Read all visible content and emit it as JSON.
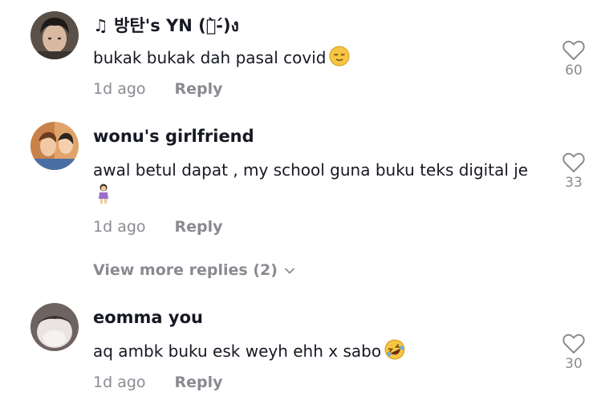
{
  "comments": [
    {
      "username": "♫ 방탄's YN (ง̀-́)ง",
      "text": "bukak bukak dah pasal covid",
      "emoji": "relieved-face-emoji",
      "time": "1d ago",
      "reply_label": "Reply",
      "likes": "60"
    },
    {
      "username": "wonu's girlfriend",
      "text": "awal betul dapat , my school guna buku teks digital je",
      "emoji": "woman-standing-emoji",
      "time": "1d ago",
      "reply_label": "Reply",
      "likes": "33"
    },
    {
      "username": "eomma you",
      "text": "aq ambk buku esk weyh ehh x sabo",
      "emoji": "rolling-laughing-emoji",
      "time": "1d ago",
      "reply_label": "Reply",
      "likes": "30"
    }
  ],
  "view_more": "View more replies (2)",
  "colors": {
    "text": "#161823",
    "secondary": "#8a8b91",
    "background": "#ffffff"
  }
}
